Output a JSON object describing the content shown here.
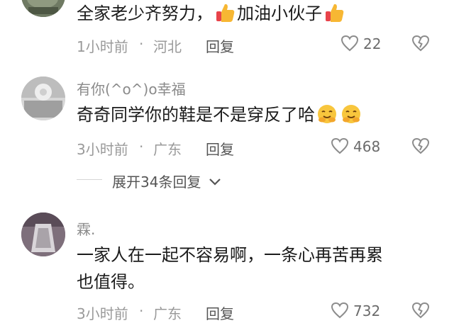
{
  "comments": [
    {
      "content_before": "全家老少齐努力，",
      "content_mid": "加油小伙子",
      "time": "1小时前",
      "location": "河北",
      "reply_label": "回复",
      "likes": "22"
    },
    {
      "username": "有你(^o^)o幸福",
      "content": "奇奇同学你的鞋是不是穿反了哈",
      "time": "3小时前",
      "location": "广东",
      "reply_label": "回复",
      "likes": "468"
    },
    {
      "username": "霖.",
      "content_line1": "一家人在一起不容易啊，一条心再苦再累",
      "content_line2": "也值得。",
      "time": "3小时前",
      "location": "广东",
      "reply_label": "回复",
      "likes": "732"
    }
  ],
  "expand_replies": "展开34条回复",
  "separator": "·",
  "icons": {
    "like": "heart-outline-icon",
    "dislike": "broken-heart-icon",
    "thumbs": "thumbs-up-emoji",
    "smile": "hugging-face-emoji",
    "chevron": "chevron-down-icon"
  },
  "colors": {
    "text": "#1b1b1b",
    "muted": "#9a9a9a",
    "username": "#8a8a8a"
  }
}
